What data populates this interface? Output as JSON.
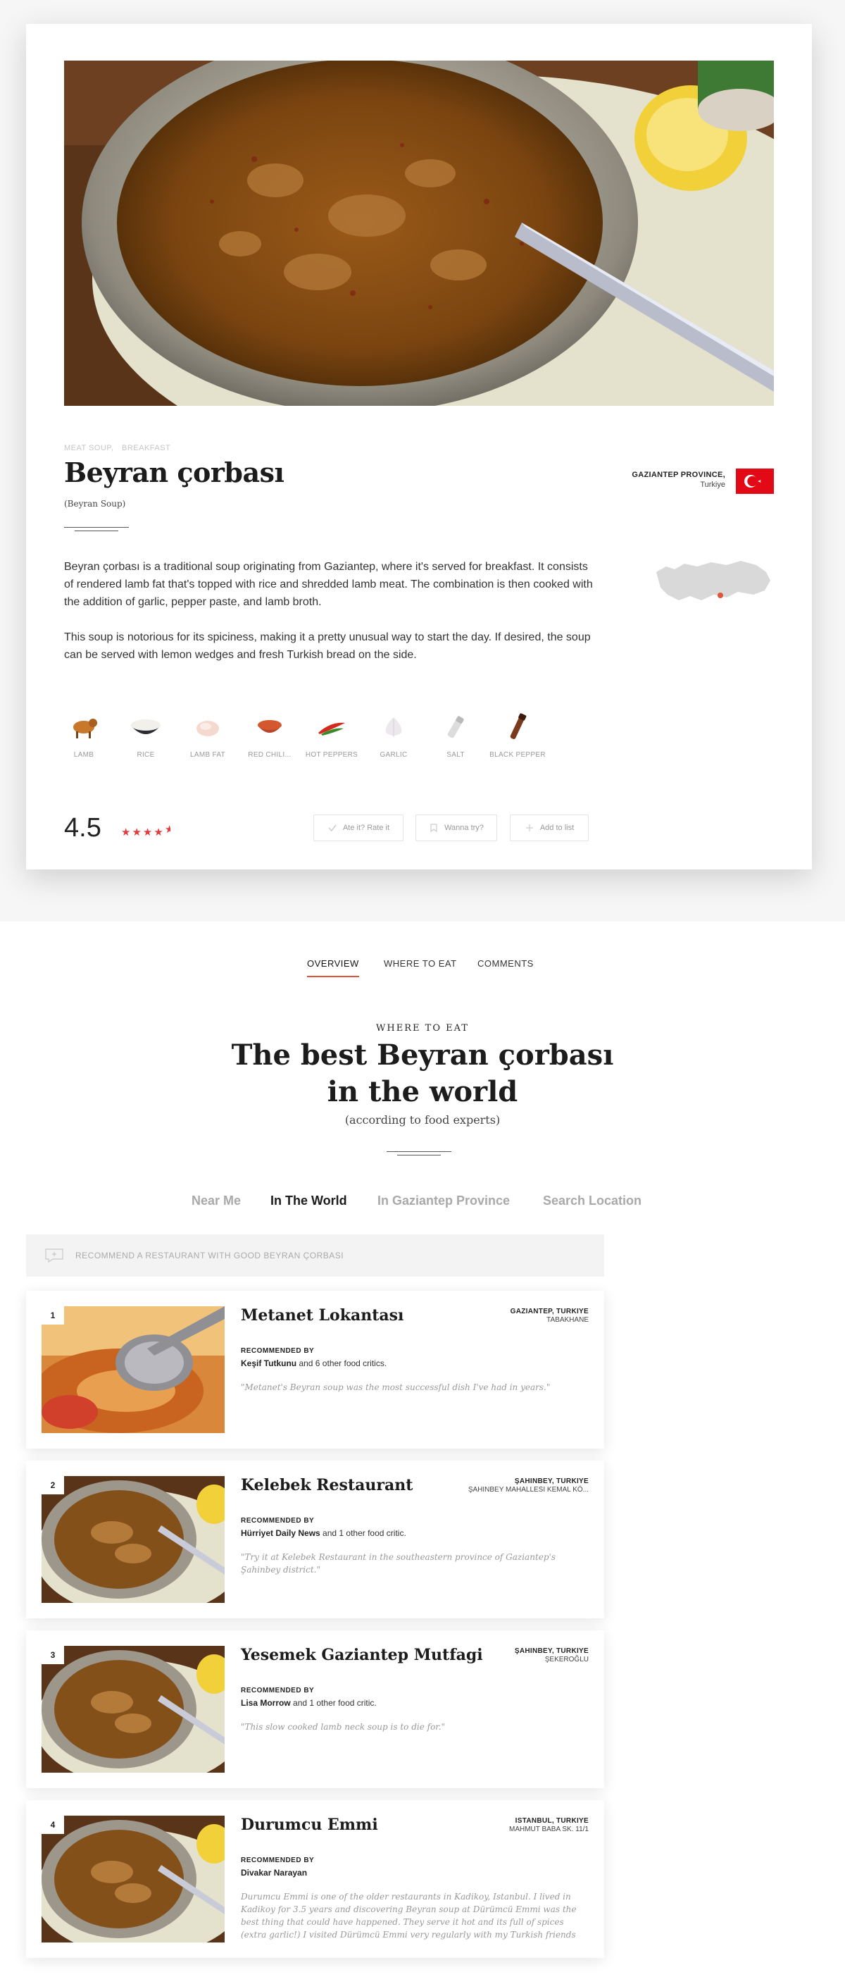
{
  "dish": {
    "tags": [
      "MEAT SOUP,",
      "BREAKFAST"
    ],
    "title": "Beyran çorbası",
    "subtitle": "(Beyran Soup)",
    "region": "GAZIANTEP PROVINCE,",
    "country": "Turkiye",
    "description": [
      "Beyran çorbası is a traditional soup originating from Gaziantep, where it's served for breakfast. It consists of rendered lamb fat that's topped with rice and shredded lamb meat. The combination is then cooked with the addition of garlic, pepper paste, and lamb broth.",
      "This soup is notorious for its spiciness, making it a pretty unusual way to start the day. If desired, the soup can be served with lemon wedges and fresh Turkish bread on the side."
    ],
    "ingredients": [
      {
        "label": "LAMB",
        "icon": "lamb-icon"
      },
      {
        "label": "RICE",
        "icon": "rice-icon"
      },
      {
        "label": "LAMB FAT",
        "icon": "lamb-fat-icon"
      },
      {
        "label": "RED CHILI...",
        "icon": "red-chili-icon"
      },
      {
        "label": "HOT PEPPERS",
        "icon": "hot-peppers-icon"
      },
      {
        "label": "GARLIC",
        "icon": "garlic-icon"
      },
      {
        "label": "SALT",
        "icon": "salt-icon"
      },
      {
        "label": "BLACK PEPPER",
        "icon": "black-pepper-icon"
      }
    ],
    "rating": "4.5",
    "rating_value": 4.5,
    "actions": {
      "ate_it": "Ate it? Rate it",
      "wanna_try": "Wanna try?",
      "add_to_list": "Add to list"
    }
  },
  "tabs": [
    "OVERVIEW",
    "WHERE TO EAT",
    "COMMENTS"
  ],
  "where_to_eat": {
    "kicker": "WHERE TO EAT",
    "title_line1": "The best Beyran çorbası",
    "title_line2": "in the world",
    "subtitle": "(according to food experts)",
    "location_tabs": [
      "Near Me",
      "In The World",
      "In Gaziantep Province",
      "Search Location"
    ],
    "active_location_tab": "In The World",
    "recommend_prompt": "RECOMMEND A RESTAURANT WITH GOOD BEYRAN ÇORBASI",
    "recommended_by_label": "RECOMMENDED BY",
    "restaurants": [
      {
        "rank": "1",
        "name": "Metanet Lokantası",
        "city": "GAZIANTEP, TURKIYE",
        "address": "TABAKHANE",
        "critic": "Keşif Tutkunu",
        "critic_suffix": " and 6 other food critics.",
        "quote": "\"Metanet's Beyran soup was the most successful dish I've had in years.\""
      },
      {
        "rank": "2",
        "name": "Kelebek Restaurant",
        "city": "ŞAHINBEY, TURKIYE",
        "address": "ŞAHINBEY MAHALLESI KEMAL KÖ...",
        "critic": "Hürriyet Daily News",
        "critic_suffix": " and 1 other food critic.",
        "quote": "\"Try it at Kelebek Restaurant in the southeastern province of Gaziantep's Şahinbey district.\""
      },
      {
        "rank": "3",
        "name": "Yesemek Gaziantep Mutfagi",
        "city": "ŞAHINBEY, TURKIYE",
        "address": "ŞEKEROĞLU",
        "critic": "Lisa Morrow",
        "critic_suffix": " and 1 other food critic.",
        "quote": "\"This slow cooked lamb neck soup is to die for.\""
      },
      {
        "rank": "4",
        "name": "Durumcu Emmi",
        "city": "ISTANBUL, TURKIYE",
        "address": "MAHMUT BABA SK. 11/1",
        "critic": "Divakar Narayan",
        "critic_suffix": "",
        "quote": "Durumcu Emmi is one of the older restaurants in Kadikoy, Istanbul. I lived in Kadikoy for 3.5 years and discovering Beyran soup at Dürümcü Emmi was the best thing that could have happened. They serve it hot and its full of spices (extra garlic!) I visited Dürümcü Emmi very regularly with my Turkish friends and even they found the sou..."
      }
    ]
  },
  "colors": {
    "accent": "#e0543a",
    "star": "#e03c3c",
    "flag_red": "#e30a17"
  }
}
